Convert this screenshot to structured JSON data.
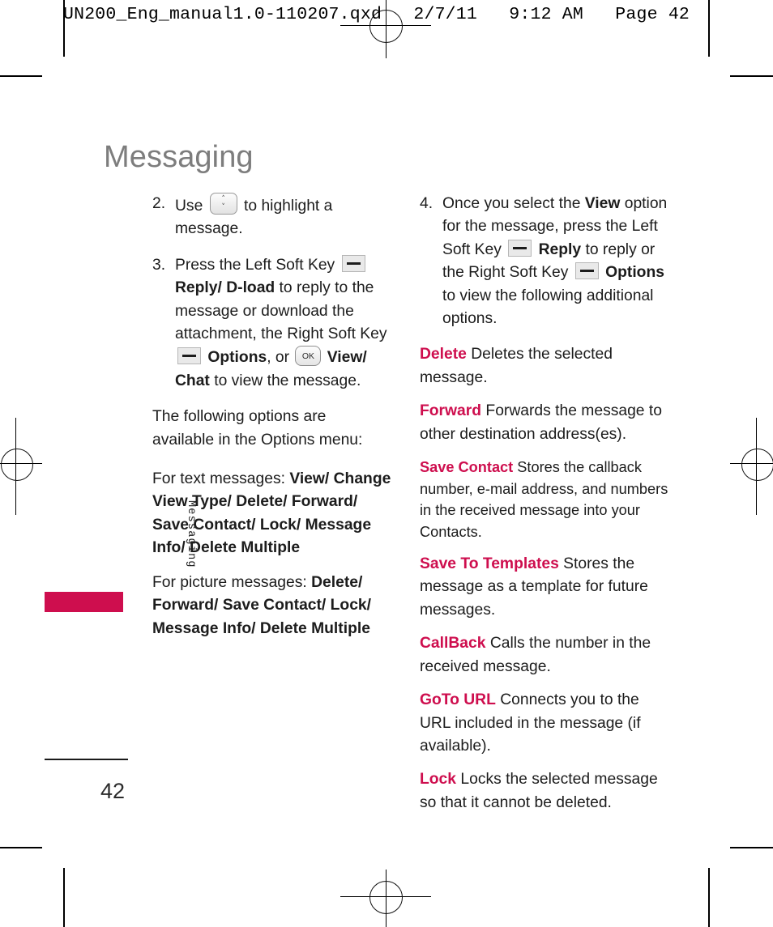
{
  "slug": "UN200_Eng_manual1.0-110207.qxd   2/7/11   9:12 AM   Page 42",
  "page_title": "Messaging",
  "side_tab": {
    "label": "Messaging",
    "color": "#ce0e4e"
  },
  "footer": {
    "page_number": "42"
  },
  "accent_color": "#ce0e4e",
  "icons": {
    "nav_key": "up-down-navigation-key-icon",
    "soft_key": "soft-key-icon",
    "ok_key": "ok-key-icon",
    "ok_label": "OK",
    "chevron_up": "˄",
    "chevron_down": "˅"
  },
  "left_column": {
    "steps": [
      {
        "num": "2.",
        "parts": [
          {
            "type": "text",
            "text": "Use "
          },
          {
            "type": "icon",
            "icon": "nav_key"
          },
          {
            "type": "text",
            "text": " to highlight a message."
          }
        ]
      },
      {
        "num": "3.",
        "parts": [
          {
            "type": "text",
            "text": "Press the Left Soft Key "
          },
          {
            "type": "icon",
            "icon": "soft_key"
          },
          {
            "type": "bold",
            "text": " Reply/ D-load"
          },
          {
            "type": "text",
            "text": " to reply to the message or download the attachment, the Right Soft Key "
          },
          {
            "type": "icon",
            "icon": "soft_key"
          },
          {
            "type": "bold",
            "text": " Options"
          },
          {
            "type": "text",
            "text": ", or "
          },
          {
            "type": "icon",
            "icon": "ok_key"
          },
          {
            "type": "bold",
            "text": " View/ Chat"
          },
          {
            "type": "text",
            "text": " to view the message."
          }
        ]
      }
    ],
    "paragraphs": [
      {
        "parts": [
          {
            "type": "text",
            "text": "The following options are available in the Options menu:"
          }
        ]
      },
      {
        "parts": [
          {
            "type": "text",
            "text": "For text messages: "
          },
          {
            "type": "bold",
            "text": "View/ Change View Type/ Delete/ Forward/ Save Contact/ Lock/ Message Info/ Delete Multiple"
          }
        ]
      },
      {
        "parts": [
          {
            "type": "text",
            "text": "For picture messages: "
          },
          {
            "type": "bold",
            "text": "Delete/ Forward/ Save Contact/ Lock/ Message Info/ Delete Multiple"
          }
        ]
      }
    ]
  },
  "right_column": {
    "steps": [
      {
        "num": "4.",
        "parts": [
          {
            "type": "text",
            "text": "Once you select the "
          },
          {
            "type": "bold",
            "text": "View"
          },
          {
            "type": "text",
            "text": " option for the message, press the Left Soft Key "
          },
          {
            "type": "icon",
            "icon": "soft_key"
          },
          {
            "type": "bold",
            "text": " Reply"
          },
          {
            "type": "text",
            "text": " to reply or the Right Soft Key "
          },
          {
            "type": "icon",
            "icon": "soft_key"
          },
          {
            "type": "bold",
            "text": " Options"
          },
          {
            "type": "text",
            "text": " to view the following additional options."
          }
        ]
      }
    ],
    "definitions": [
      {
        "term": "Delete",
        "desc": " Deletes the selected message.",
        "small": false
      },
      {
        "term": "Forward",
        "desc": " Forwards the message to other destination address(es).",
        "small": false
      },
      {
        "term": "Save Contact",
        "desc": " Stores the callback number, e-mail address, and numbers in the received message into your Contacts.",
        "small": true
      },
      {
        "term": "Save To Templates",
        "desc": " Stores the message as a template for future messages.",
        "small": false
      },
      {
        "term": "CallBack",
        "desc": " Calls the number in the received message.",
        "small": false
      },
      {
        "term": "GoTo URL",
        "desc": " Connects you to the URL included in the message (if available).",
        "small": false
      },
      {
        "term": "Lock",
        "desc": " Locks the selected message so that it cannot be deleted.",
        "small": false
      }
    ]
  }
}
